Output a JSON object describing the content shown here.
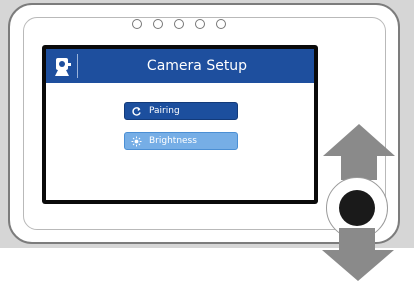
{
  "screen": {
    "title": "Camera Setup",
    "title_icon": "camera-icon",
    "menu": [
      {
        "label": "Pairing",
        "icon": "refresh-icon",
        "state": "selected"
      },
      {
        "label": "Brightness",
        "icon": "sun-icon",
        "state": "normal"
      }
    ]
  },
  "device": {
    "indicator_leds": 5,
    "control": "round-button",
    "arrows": [
      "up-arrow",
      "down-arrow"
    ]
  },
  "colors": {
    "title_bar": "#1e4f9e",
    "selected_button": "#1c4f9e",
    "normal_button": "#76aee6",
    "arrow": "#8a8a8a"
  }
}
